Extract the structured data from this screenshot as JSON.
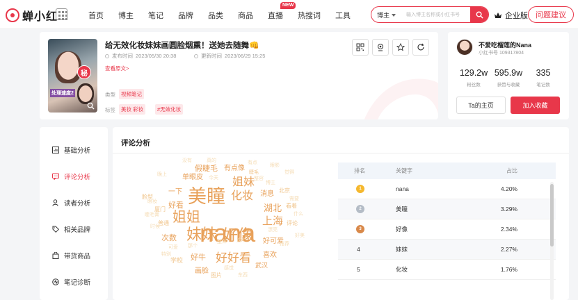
{
  "brand": {
    "name": "蝉小红",
    "accent": "#e8374a"
  },
  "nav": {
    "items": [
      "首页",
      "博主",
      "笔记",
      "品牌",
      "品类",
      "商品",
      "直播",
      "热搜词",
      "工具"
    ],
    "new_badge": "NEW"
  },
  "search": {
    "scope": "博主",
    "placeholder": "输入博主名称或小红书号"
  },
  "header_right": {
    "enterprise": "企业版",
    "feedback": "问题建议"
  },
  "note": {
    "title": "给无效化妆妹妹画圆脸烟熏！送她去随舞👊",
    "published_label": "发布时间",
    "published": "2023/05/30 20:38",
    "updated_label": "更新时间",
    "updated": "2023/06/29 15:25",
    "view_original": "查看原文>",
    "type_label": "类型",
    "type": "视频笔记",
    "tags_label": "标签",
    "tags": [
      "美妆 彩妆",
      "#无效化妆"
    ],
    "thumb_badge": "秘",
    "thumb_caption": "处理速度2"
  },
  "profile": {
    "name": "不爱吃榴莲的Nana",
    "id_label": "小红书号",
    "id": "109317804",
    "stats": [
      {
        "value": "129.2w",
        "label": "粉丝数"
      },
      {
        "value": "595.9w",
        "label": "获赞与收藏"
      },
      {
        "value": "335",
        "label": "笔记数"
      }
    ],
    "home_button": "Ta的主页",
    "fav_button": "加入收藏"
  },
  "sidebar": {
    "items": [
      {
        "label": "基础分析",
        "icon": "bar-chart-icon",
        "active": false
      },
      {
        "label": "评论分析",
        "icon": "comment-icon",
        "active": true
      },
      {
        "label": "读者分析",
        "icon": "user-icon",
        "active": false
      },
      {
        "label": "相关品牌",
        "icon": "tag-icon",
        "active": false
      },
      {
        "label": "带货商品",
        "icon": "bag-icon",
        "active": false
      },
      {
        "label": "笔记诊断",
        "icon": "diagnosis-icon",
        "active": false
      }
    ]
  },
  "analysis": {
    "title": "评论分析",
    "cloud_watermark": "蝉小红",
    "cloud_words": [
      "nana",
      "美瞳",
      "妹妹",
      "好像",
      "姐姐",
      "化妆",
      "上海",
      "好好看",
      "姐妹",
      "湖北",
      "假睫毛",
      "有点像",
      "单眼皮",
      "好可爱",
      "喜欢",
      "一下",
      "好看",
      "消息",
      "次数",
      "好牛",
      "画脸",
      "武汉",
      "睫毛",
      "学校",
      "脸型",
      "厦门",
      "北京",
      "评论",
      "看着",
      "图片",
      "普通",
      "没有",
      "特别",
      "可爱",
      "觉得",
      "好美",
      "有点",
      "真的",
      "整容",
      "感觉",
      "东西",
      "今天",
      "推荐",
      "博主",
      "需要",
      "什么",
      "漂亮",
      "眼妆",
      "睫毛膏",
      "眼影",
      "整体",
      "时候",
      "晚上",
      "这个",
      "那个"
    ],
    "table": {
      "headers": {
        "rank": "排名",
        "keyword": "关键字",
        "ratio": "占比"
      },
      "rows": [
        {
          "rank": "1",
          "keyword": "nana",
          "ratio": "4.20%"
        },
        {
          "rank": "2",
          "keyword": "美瞳",
          "ratio": "3.29%"
        },
        {
          "rank": "3",
          "keyword": "好像",
          "ratio": "2.34%"
        },
        {
          "rank": "4",
          "keyword": "妹妹",
          "ratio": "2.27%"
        },
        {
          "rank": "5",
          "keyword": "化妆",
          "ratio": "1.76%"
        }
      ]
    }
  }
}
